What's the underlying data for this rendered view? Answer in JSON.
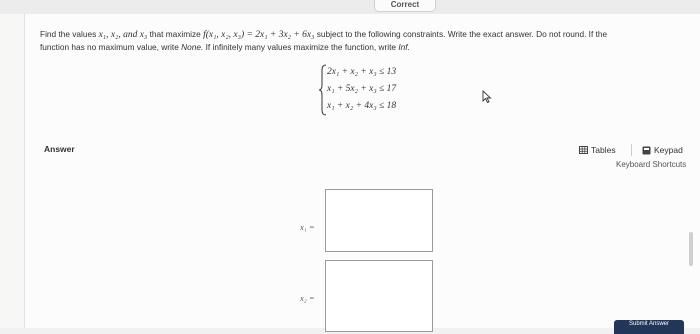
{
  "top_tab": {
    "label": "Correct"
  },
  "question": {
    "prefix": "Find the values",
    "vars_inline": "x₁, x₂, and x₃",
    "mid": "that maximize",
    "function": "f(x₁, x₂, x₃) = 2x₁ + 3x₂ + 6x₃",
    "suffix": "subject to the following constraints. Write the exact answer. Do not round. If the",
    "line2_a": "function has no maximum value, write",
    "none_word": "None.",
    "line2_b": "If infinitely many values maximize the function, write",
    "inf_word": "Inf."
  },
  "constraints": [
    {
      "text": "2x₁ + x₂ + x₃  ≤  13"
    },
    {
      "text": "x₁ + 5x₂ + x₃  ≤  17"
    },
    {
      "text": "x₁ + x₂ + 4x₃  ≤  18"
    }
  ],
  "answer": {
    "label": "Answer"
  },
  "tools": {
    "tables_label": "Tables",
    "keypad_label": "Keypad",
    "shortcuts_label": "Keyboard Shortcuts"
  },
  "inputs": [
    {
      "var": "x₁ =",
      "value": ""
    },
    {
      "var": "x₂ =",
      "value": ""
    }
  ],
  "submit": {
    "label": "Submit Answer"
  }
}
